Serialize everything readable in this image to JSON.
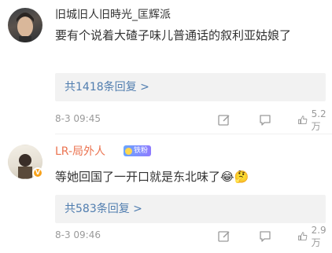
{
  "comments": [
    {
      "username": "旧城旧人旧時光_匡辉派",
      "text": "要有个说着大碴子味儿普通话的叙利亚姑娘了",
      "reply_link": "共1418条回复 >",
      "time": "8-3 09:45",
      "likes": "5.2万"
    },
    {
      "username": "LR-局外人",
      "badge": "铁粉",
      "text": "等她回国了一开口就是东北味了😂🤔",
      "reply_link": "共583条回复 >",
      "time": "8-3 09:46",
      "likes": "2.9万",
      "verified_mark": "V"
    }
  ],
  "colors": {
    "accent_link": "#507daf",
    "orange_name": "#eb7350",
    "muted": "#9a9a9a"
  },
  "icons": [
    "edit-icon",
    "comment-icon",
    "like-icon",
    "verified-badge-icon"
  ]
}
